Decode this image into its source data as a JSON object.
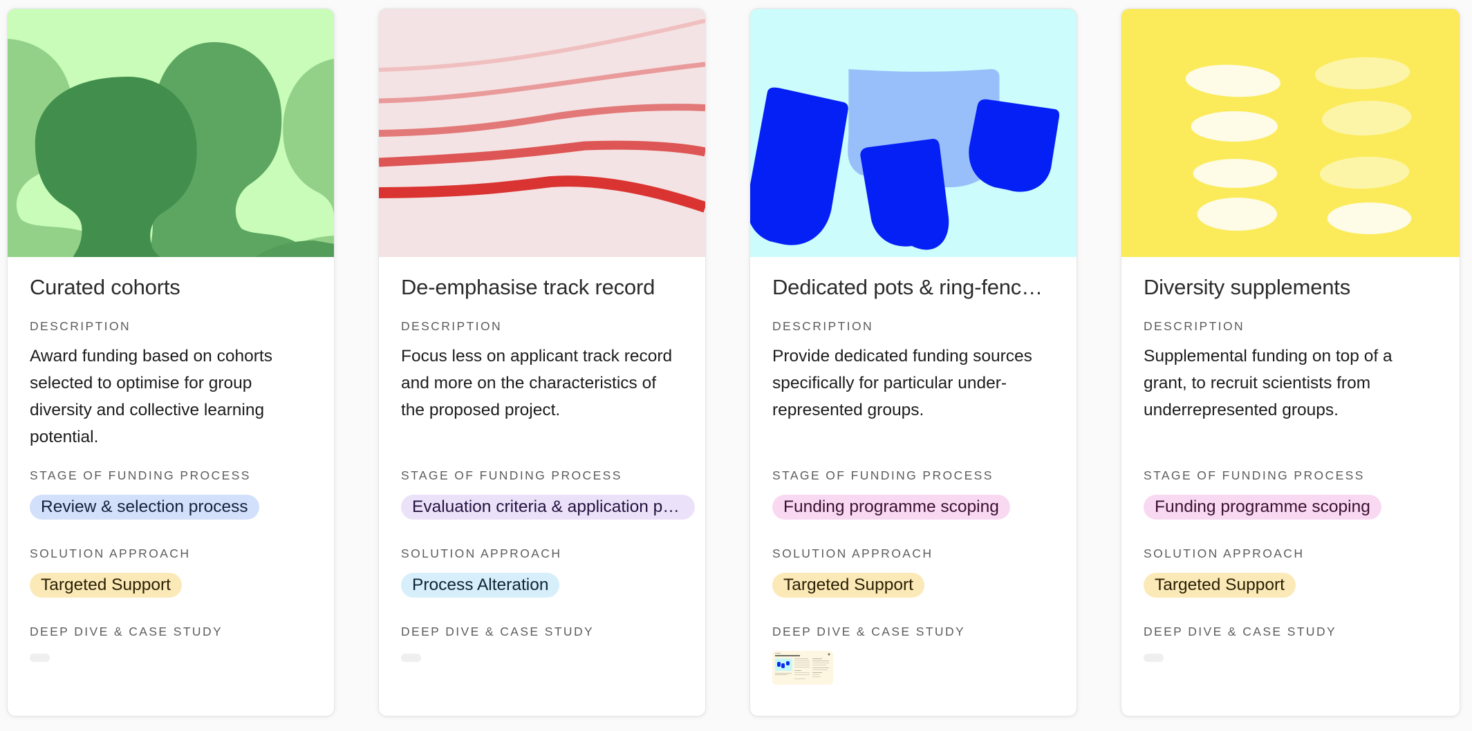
{
  "labels": {
    "description": "Description",
    "stage": "Stage of funding process",
    "solution": "Solution approach",
    "deep_dive": "Deep dive & case study"
  },
  "cards": [
    {
      "title": "Curated cohorts",
      "cover_icon": "people-silhouettes-illustration",
      "cover_bg": "#c8fcb8",
      "description": "Award funding based on cohorts selected to optimise for group diversity and collective learning potential.",
      "stage": {
        "label": "Review & selection process",
        "bg": "#d2e0fb",
        "fg": "#14213d"
      },
      "solution": {
        "label": "Targeted Support",
        "bg": "#fbe9b7",
        "fg": "#2a1f05"
      },
      "deep_dive": {
        "type": "empty"
      }
    },
    {
      "title": "De-emphasise track record",
      "cover_icon": "wavy-lines-illustration",
      "cover_bg": "#f4e3e4",
      "description": "Focus less on applicant track record and more on the characteristics of the proposed project.",
      "stage": {
        "label": "Evaluation criteria & application process",
        "bg": "#ebe2fa",
        "fg": "#23123d"
      },
      "solution": {
        "label": "Process Alteration",
        "bg": "#d6effa",
        "fg": "#0d2435"
      },
      "deep_dive": {
        "type": "empty"
      }
    },
    {
      "title": "Dedicated pots & ring-fenced funding",
      "cover_icon": "funding-pots-illustration",
      "cover_bg": "#ccfcfb",
      "description": "Provide dedicated funding sources specifically for particular under-represented groups.",
      "stage": {
        "label": "Funding programme scoping",
        "bg": "#f9d9f2",
        "fg": "#3a0f30"
      },
      "solution": {
        "label": "Targeted Support",
        "bg": "#fbe9b7",
        "fg": "#2a1f05"
      },
      "deep_dive": {
        "type": "thumbnail",
        "thumbnail_icon": "case-study-document-thumbnail"
      }
    },
    {
      "title": "Diversity supplements",
      "cover_icon": "coin-stacks-illustration",
      "cover_bg": "#fbeb5a",
      "description": "Supplemental funding on top of a grant, to recruit scientists from underrepresented groups.",
      "stage": {
        "label": "Funding programme scoping",
        "bg": "#f9d9f2",
        "fg": "#3a0f30"
      },
      "solution": {
        "label": "Targeted Support",
        "bg": "#fbe9b7",
        "fg": "#2a1f05"
      },
      "deep_dive": {
        "type": "empty"
      }
    }
  ]
}
